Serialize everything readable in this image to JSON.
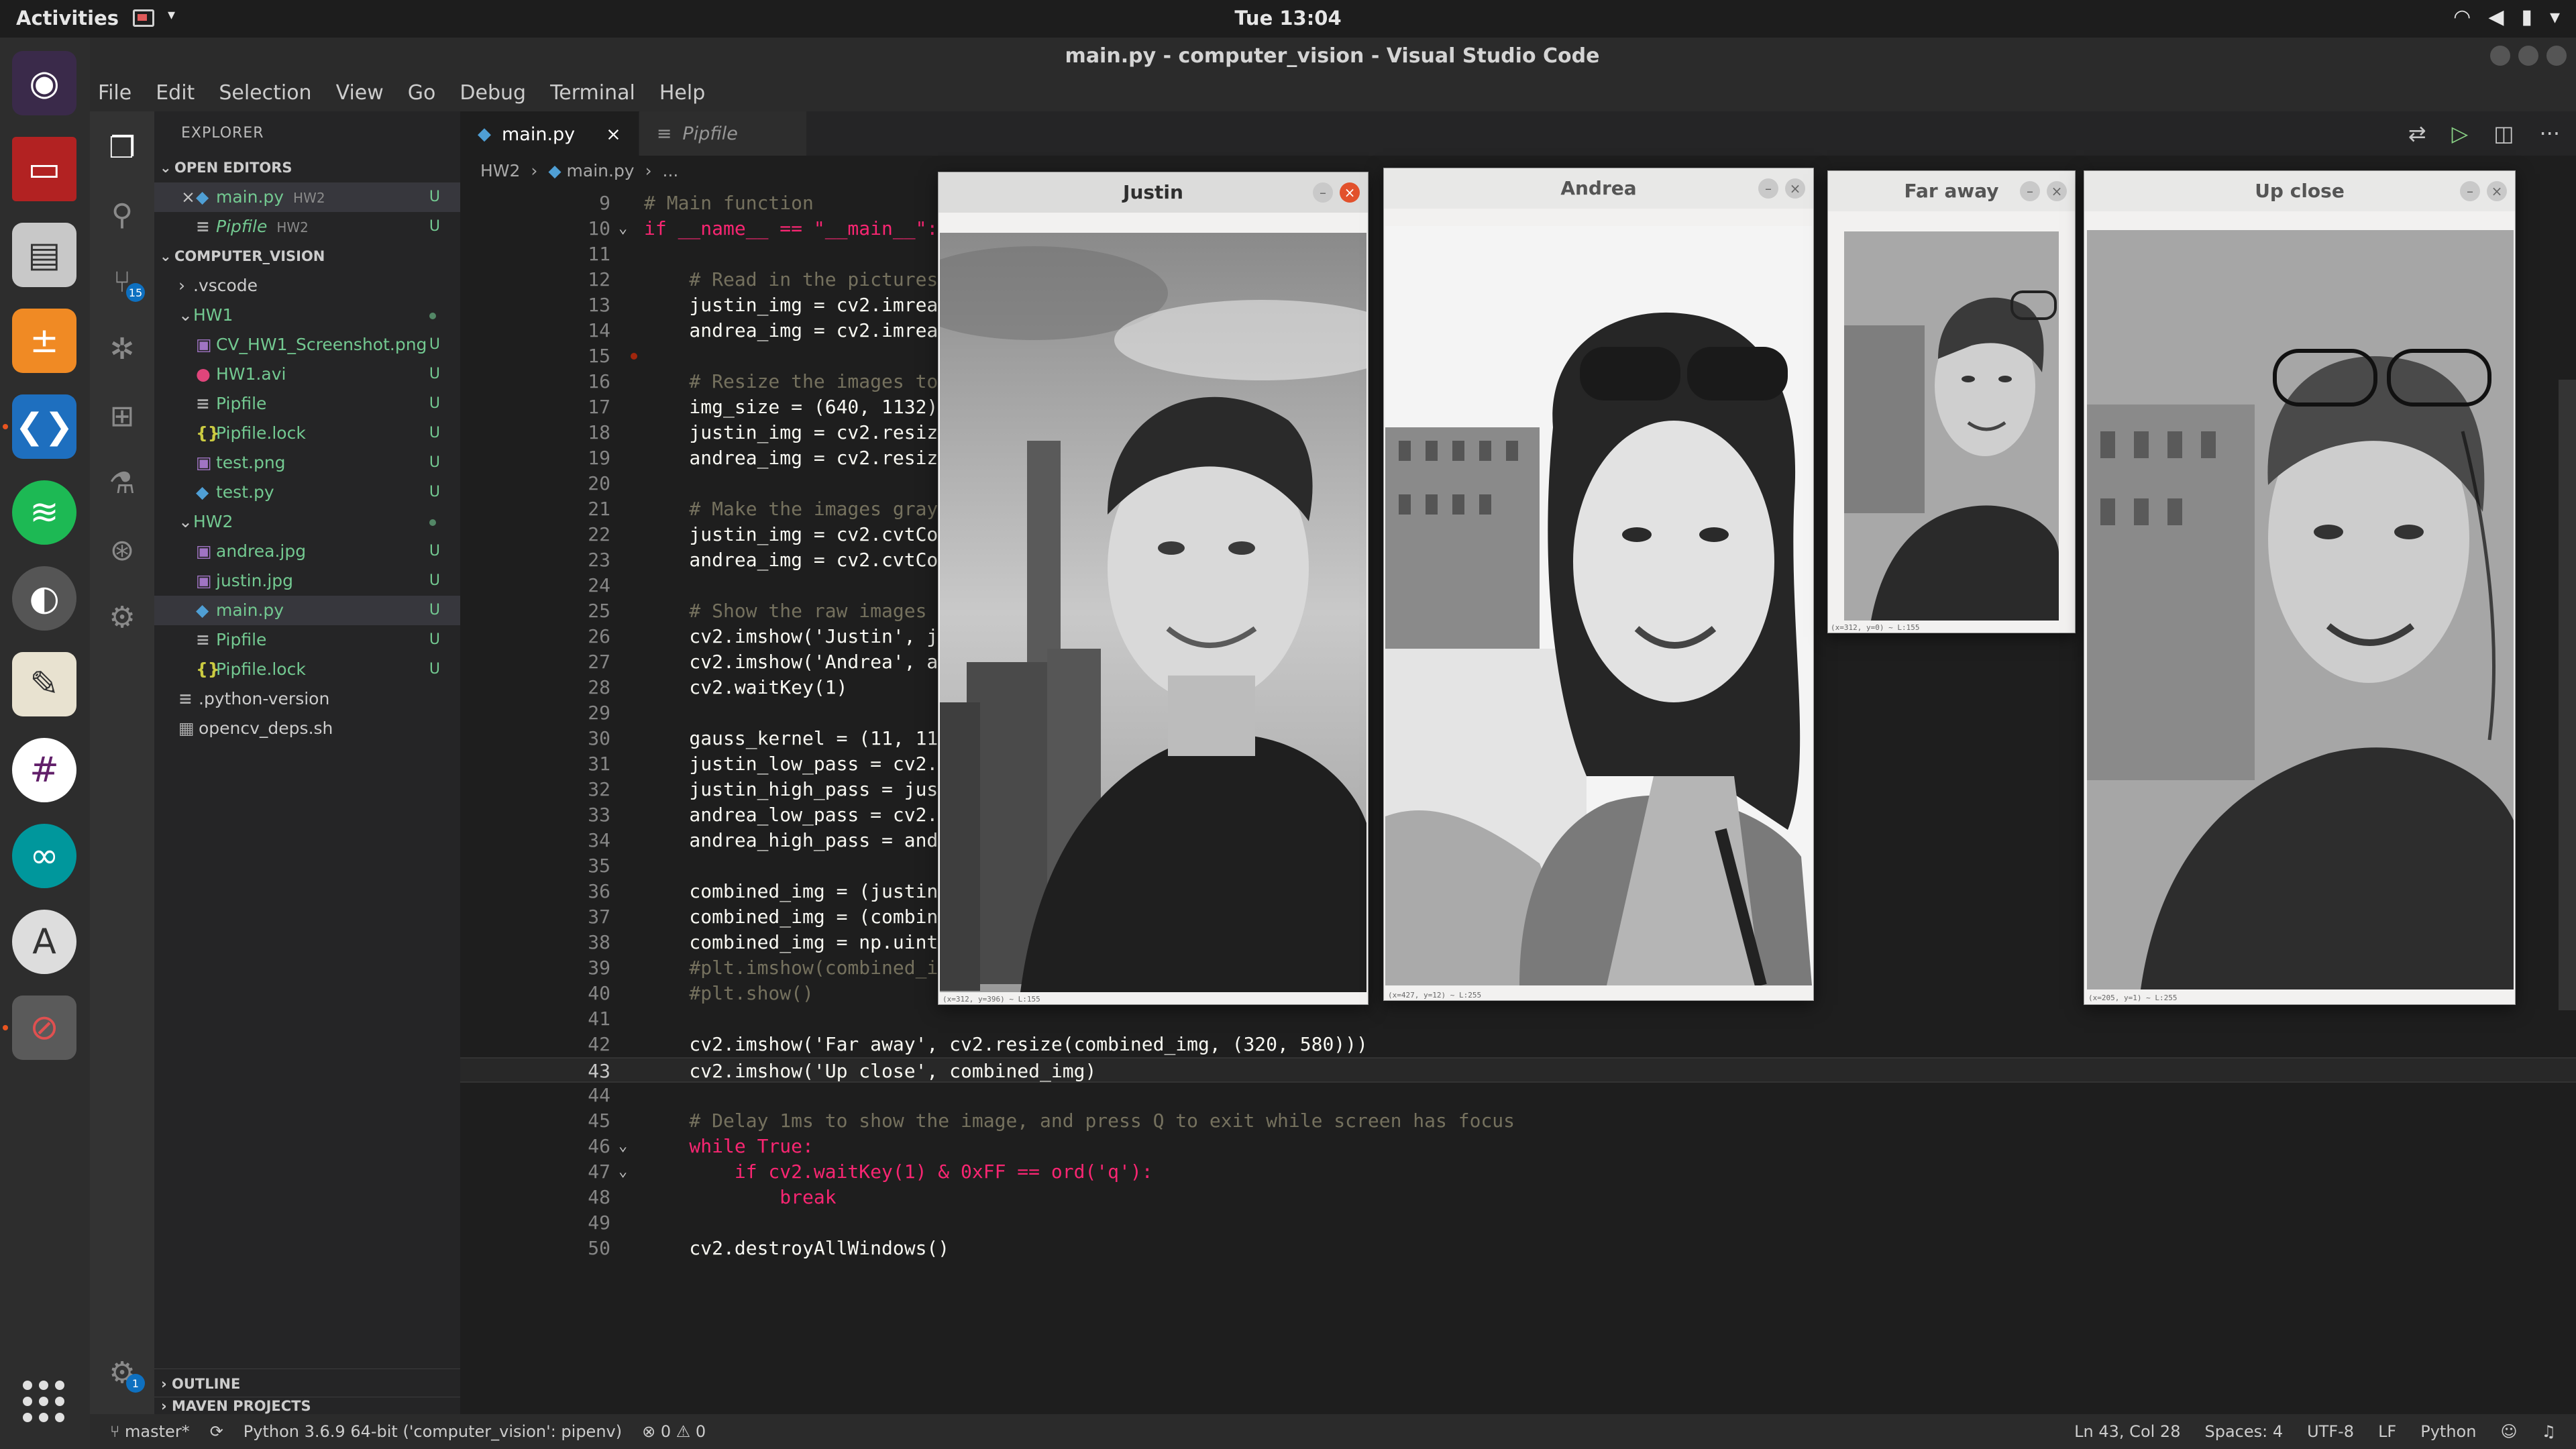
{
  "topbar": {
    "activities": "Activities",
    "clock": "Tue 13:04"
  },
  "window": {
    "title": "main.py - computer_vision - Visual Studio Code"
  },
  "menu": [
    "File",
    "Edit",
    "Selection",
    "View",
    "Go",
    "Debug",
    "Terminal",
    "Help"
  ],
  "activity_badges": {
    "scm": "15",
    "manage": "1"
  },
  "explorer": {
    "title": "EXPLORER",
    "open_editors_label": "OPEN EDITORS",
    "open_editors": [
      {
        "name": "main.py",
        "folder": "HW2",
        "status": "U"
      },
      {
        "name": "Pipfile",
        "folder": "HW2",
        "status": "U"
      }
    ],
    "project_label": "COMPUTER_VISION",
    "tree": [
      {
        "name": ".vscode",
        "status": ""
      },
      {
        "name": "HW1",
        "status": ""
      },
      {
        "name": "CV_HW1_Screenshot.png",
        "status": "U"
      },
      {
        "name": "HW1.avi",
        "status": "U"
      },
      {
        "name": "Pipfile",
        "status": "U"
      },
      {
        "name": "Pipfile.lock",
        "status": "U"
      },
      {
        "name": "test.png",
        "status": "U"
      },
      {
        "name": "test.py",
        "status": "U"
      },
      {
        "name": "HW2",
        "status": ""
      },
      {
        "name": "andrea.jpg",
        "status": "U"
      },
      {
        "name": "justin.jpg",
        "status": "U"
      },
      {
        "name": "main.py",
        "status": "U"
      },
      {
        "name": "Pipfile",
        "status": "U"
      },
      {
        "name": "Pipfile.lock",
        "status": "U"
      },
      {
        "name": ".python-version",
        "status": ""
      },
      {
        "name": "opencv_deps.sh",
        "status": ""
      }
    ],
    "outline_label": "OUTLINE",
    "maven_label": "MAVEN PROJECTS"
  },
  "tabs": [
    {
      "label": "main.py",
      "close": "×"
    },
    {
      "label": "Pipfile"
    }
  ],
  "breadcrumb": {
    "folder": "HW2",
    "file": "main.py",
    "more": "..."
  },
  "code": {
    "lines": [
      {
        "n": "9",
        "text": "# Main function"
      },
      {
        "n": "10",
        "text": "if __name__ == \"__main__\":"
      },
      {
        "n": "11",
        "text": ""
      },
      {
        "n": "12",
        "text": "    # Read in the pictures"
      },
      {
        "n": "13",
        "text": "    justin_img = cv2.imread(\"justi"
      },
      {
        "n": "14",
        "text": "    andrea_img = cv2.imread(\"andre"
      },
      {
        "n": "15",
        "text": ""
      },
      {
        "n": "16",
        "text": "    # Resize the images to be the"
      },
      {
        "n": "17",
        "text": "    img_size = (640, 1132)"
      },
      {
        "n": "18",
        "text": "    justin_img = cv2.resize(justin"
      },
      {
        "n": "19",
        "text": "    andrea_img = cv2.resize(andrea"
      },
      {
        "n": "20",
        "text": ""
      },
      {
        "n": "21",
        "text": "    # Make the images grayscale"
      },
      {
        "n": "22",
        "text": "    justin_img = cv2.cvtColor(just"
      },
      {
        "n": "23",
        "text": "    andrea_img = cv2.cvtColor(andr"
      },
      {
        "n": "24",
        "text": ""
      },
      {
        "n": "25",
        "text": "    # Show the raw images"
      },
      {
        "n": "26",
        "text": "    cv2.imshow('Justin', justin_im"
      },
      {
        "n": "27",
        "text": "    cv2.imshow('Andrea', andrea_im"
      },
      {
        "n": "28",
        "text": "    cv2.waitKey(1)"
      },
      {
        "n": "29",
        "text": ""
      },
      {
        "n": "30",
        "text": "    gauss_kernel = (11, 11)#(55, 5"
      },
      {
        "n": "31",
        "text": "    justin_low_pass = cv2.Gaussian"
      },
      {
        "n": "32",
        "text": "    justin_high_pass = justin_img "
      },
      {
        "n": "33",
        "text": "    andrea_low_pass = cv2.Gaussian"
      },
      {
        "n": "34",
        "text": "    andrea_high_pass = andrea_img "
      },
      {
        "n": "35",
        "text": ""
      },
      {
        "n": "36",
        "text": "    combined_img = (justin_low_pas"
      },
      {
        "n": "37",
        "text": "    combined_img = (combined_img -"
      },
      {
        "n": "38",
        "text": "    combined_img = np.uint8(combin"
      },
      {
        "n": "39",
        "text": "    #plt.imshow(combined_img, cmap"
      },
      {
        "n": "40",
        "text": "    #plt.show()"
      },
      {
        "n": "41",
        "text": ""
      },
      {
        "n": "42",
        "text": "    cv2.imshow('Far away', cv2.resize(combined_img, (320, 580)))"
      },
      {
        "n": "43",
        "text": "    cv2.imshow('Up close', combined_img)"
      },
      {
        "n": "44",
        "text": ""
      },
      {
        "n": "45",
        "text": "    # Delay 1ms to show the image, and press Q to exit while screen has focus"
      },
      {
        "n": "46",
        "text": "    while True:"
      },
      {
        "n": "47",
        "text": "        if cv2.waitKey(1) & 0xFF == ord('q'):"
      },
      {
        "n": "48",
        "text": "            break"
      },
      {
        "n": "49",
        "text": ""
      },
      {
        "n": "50",
        "text": "    cv2.destroyAllWindows()"
      }
    ],
    "peek_fragments": [
      "DE",
      "DE",
      "("
    ]
  },
  "image_windows": [
    {
      "title": "Justin",
      "status": "(x=312, y=396) ~ L:155"
    },
    {
      "title": "Andrea",
      "status": "(x=427, y=12) ~ L:255"
    },
    {
      "title": "Far away",
      "status": "(x=312, y=0) ~ L:155"
    },
    {
      "title": "Up close",
      "status": "(x=205, y=1) ~ L:255"
    }
  ],
  "statusbar": {
    "branch": "master*",
    "interpreter": "Python 3.6.9 64-bit ('computer_vision': pipenv)",
    "errors": "0",
    "warnings": "0",
    "cursor": "Ln 43, Col 28",
    "spaces": "Spaces: 4",
    "encoding": "UTF-8",
    "eol": "LF",
    "language": "Python"
  }
}
